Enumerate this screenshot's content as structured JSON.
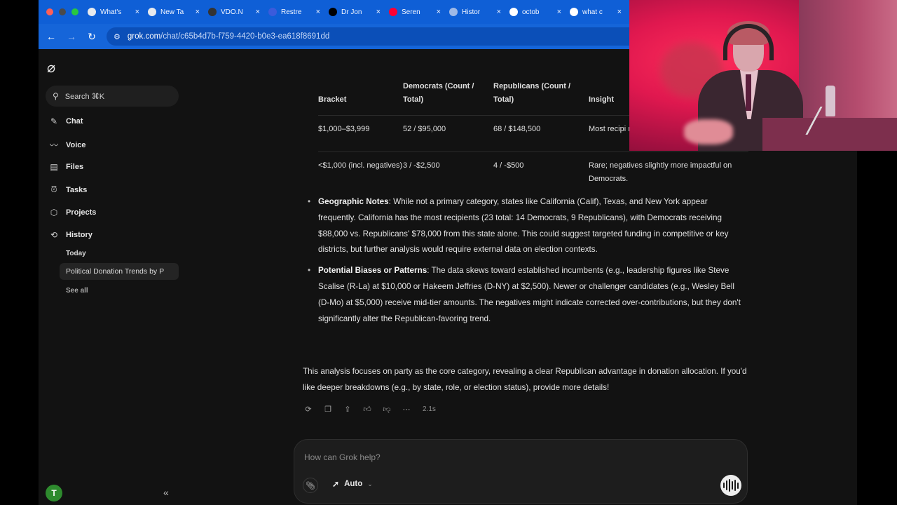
{
  "browser": {
    "tabs": [
      {
        "title": "What's",
        "favicon": "chrome-icon",
        "color": "#e8eaed"
      },
      {
        "title": "New Ta",
        "favicon": "chrome-icon",
        "color": "#e8eaed"
      },
      {
        "title": "VDO.N",
        "favicon": "vdo-ninja-icon",
        "color": "#333333"
      },
      {
        "title": "Restre",
        "favicon": "restream-icon",
        "color": "#3b5bdb"
      },
      {
        "title": "Dr Jon",
        "favicon": "x-icon",
        "color": "#000000"
      },
      {
        "title": "Seren",
        "favicon": "youtube-icon",
        "color": "#ff0033"
      },
      {
        "title": "Histor",
        "favicon": "history-site-icon",
        "color": "#9fb9e6"
      },
      {
        "title": "octob",
        "favicon": "google-icon",
        "color": "#ffffff"
      },
      {
        "title": "what c",
        "favicon": "google-icon",
        "color": "#ffffff"
      }
    ],
    "url_host": "grok.com",
    "url_path": "/chat/c65b4d7b-f759-4420-b0e3-ea618f8691dd"
  },
  "sidebar": {
    "search_label": "Search ⌘K",
    "items": [
      {
        "label": "Chat",
        "icon": "edit-icon"
      },
      {
        "label": "Voice",
        "icon": "waveform-icon"
      },
      {
        "label": "Files",
        "icon": "file-icon"
      },
      {
        "label": "Tasks",
        "icon": "alarm-icon"
      },
      {
        "label": "Projects",
        "icon": "cube-icon"
      },
      {
        "label": "History",
        "icon": "history-icon"
      }
    ],
    "today_label": "Today",
    "history_item": "Political Donation Trends by P",
    "see_all": "See all",
    "avatar_initial": "T"
  },
  "table": {
    "headers": [
      "Bracket",
      "Democrats (Count / Total)",
      "Republicans (Count / Total)",
      "Insight"
    ],
    "rows": [
      [
        "$1,000–$3,999",
        "52 / $95,000",
        "68 / $148,500",
        "Most recipi more entrie"
      ],
      [
        "<$1,000 (incl. negatives)",
        "3 / -$2,500",
        "4 / -$500",
        "Rare; negatives slightly more impactful on Democrats."
      ]
    ]
  },
  "notes": [
    {
      "title": "Geographic Notes",
      "text": ": While not a primary category, states like California (Calif), Texas, and New York appear frequently. California has the most recipients (23 total: 14 Democrats, 9 Republicans), with Democrats receiving $88,000 vs. Republicans' $78,000 from this state alone. This could suggest targeted funding in competitive or key districts, but further analysis would require external data on election contexts."
    },
    {
      "title": "Potential Biases or Patterns",
      "text": ": The data skews toward established incumbents (e.g., leadership figures like Steve Scalise (R-La) at $10,000 or Hakeem Jeffries (D-NY) at $2,500). Newer or challenger candidates (e.g., Wesley Bell (D-Mo) at $5,000) receive mid-tier amounts. The negatives might indicate corrected over-contributions, but they don't significantly alter the Republican-favoring trend."
    }
  ],
  "summary": "This analysis focuses on party as the core category, revealing a clear Republican advantage in donation allocation. If you'd like deeper breakdowns (e.g., by state, role, or election status), provide more details!",
  "response_time": "2.1s",
  "composer": {
    "placeholder": "How can Grok help?",
    "mode_label": "Auto"
  },
  "colors": {
    "tab_strip": "#0f5fd6",
    "address_bar": "#1565d9",
    "background": "#121212",
    "composer": "#1d1d1d"
  }
}
